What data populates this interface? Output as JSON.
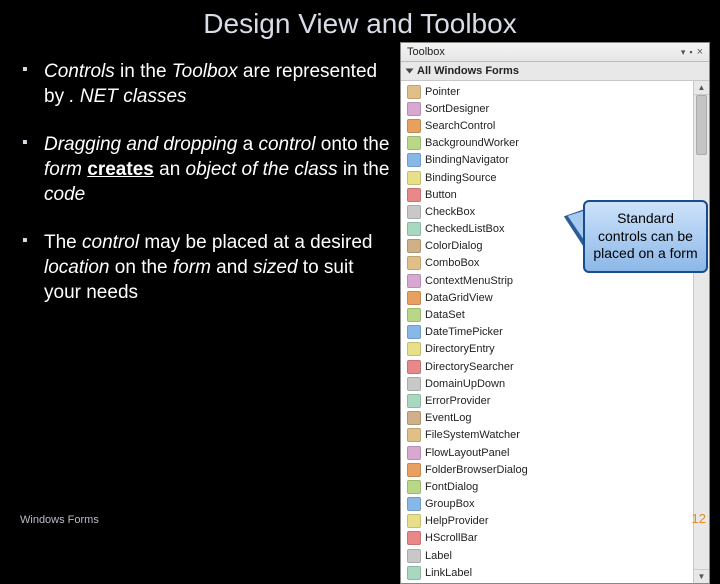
{
  "title": "Design View and Toolbox",
  "bullets": [
    "<em>Controls</em> in the <em>Toolbox</em> are represented by <em>. NET classes</em>",
    "<em>Dragging and dropping</em> a <em>control</em> onto the <em>form</em> <u><strong>creates</strong></u> an <em>object of the class</em> in the <em>code</em>",
    "The <em>control</em> may be placed at a desired <em>location</em> on the <em>form</em> and <em>sized</em> to suit your needs"
  ],
  "footer_left": "Windows Forms",
  "footer_right": "12",
  "toolbox": {
    "panel_title": "Toolbox",
    "header": "All Windows Forms",
    "items": [
      "Pointer",
      "SortDesigner",
      "SearchControl",
      "BackgroundWorker",
      "BindingNavigator",
      "BindingSource",
      "Button",
      "CheckBox",
      "CheckedListBox",
      "ColorDialog",
      "ComboBox",
      "ContextMenuStrip",
      "DataGridView",
      "DataSet",
      "DateTimePicker",
      "DirectoryEntry",
      "DirectorySearcher",
      "DomainUpDown",
      "ErrorProvider",
      "EventLog",
      "FileSystemWatcher",
      "FlowLayoutPanel",
      "FolderBrowserDialog",
      "FontDialog",
      "GroupBox",
      "HelpProvider",
      "HScrollBar",
      "Label",
      "LinkLabel"
    ]
  },
  "callout": "Standard controls can be placed on a form"
}
